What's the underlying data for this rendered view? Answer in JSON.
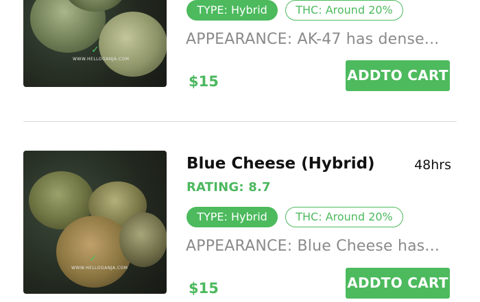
{
  "products": [
    {
      "title": "",
      "eta": "",
      "rating": "",
      "type_chip": "TYPE: Hybrid",
      "thc_chip": "THC: Around 20%",
      "appearance": "APPEARANCE: AK-47 has dense...",
      "price": "$15",
      "cart_label": "ADDTO CART",
      "image_watermark": "WWW.HELLOGANJA.COM"
    },
    {
      "title": "Blue Cheese (Hybrid)",
      "eta": "48hrs",
      "rating": "RATING: 8.7",
      "type_chip": "TYPE: Hybrid",
      "thc_chip": "THC: Around 20%",
      "appearance": "APPEARANCE: Blue Cheese has...",
      "price": "$15",
      "cart_label": "ADDTO CART",
      "image_watermark": "WWW.HELLOGANJA.COM"
    }
  ],
  "colors": {
    "accent": "#4cba5d",
    "muted_text": "#8a8a8a",
    "divider": "#dcdcdc"
  }
}
